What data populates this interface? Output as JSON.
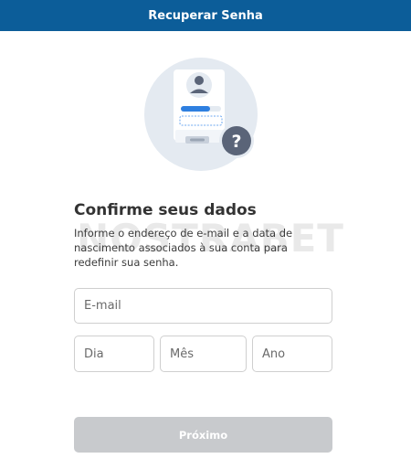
{
  "header": {
    "title": "Recuperar Senha"
  },
  "watermark": {
    "text": "NOSTRABET"
  },
  "content": {
    "title": "Confirme seus dados",
    "description": "Informe o endereço de e-mail e a data de nascimento associados à sua conta para redefinir sua senha."
  },
  "form": {
    "email_placeholder": "E-mail",
    "day_placeholder": "Dia",
    "month_placeholder": "Mês",
    "year_placeholder": "Ano",
    "next_label": "Próximo"
  },
  "colors": {
    "header_bg": "#0c5d99",
    "button_disabled": "#c8cacd",
    "illustration_circle": "#e4eaf1",
    "accent_blue": "#2e7fe0",
    "help_badge": "#5a6478"
  },
  "icons": [
    "account-recovery-illustration",
    "user-avatar-icon",
    "question-mark-icon"
  ]
}
